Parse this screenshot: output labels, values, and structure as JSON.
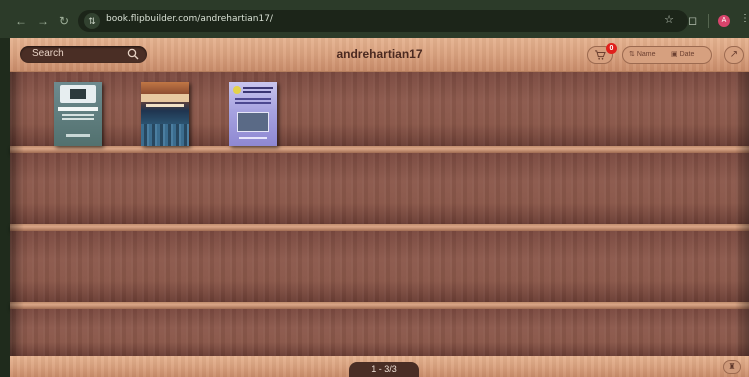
{
  "browser": {
    "url": "book.flipbuilder.com/andrehartian17/",
    "profile_initial": "A"
  },
  "toolbar": {
    "search_label": "Search",
    "title": "andrehartian17",
    "cart_count": "0",
    "sort_name_label": "Name",
    "sort_date_label": "Date"
  },
  "pagination": {
    "label": "1 - 3/3"
  },
  "books": [
    {
      "cover": "teal-laptop-cover"
    },
    {
      "cover": "city-skyline-cover"
    },
    {
      "cover": "purple-report-cover"
    }
  ],
  "colors": {
    "wood_light": "#d9a07d",
    "wood_dark": "#8d5a4d",
    "badge": "#e0201c",
    "chrome": "#2c3b29"
  }
}
